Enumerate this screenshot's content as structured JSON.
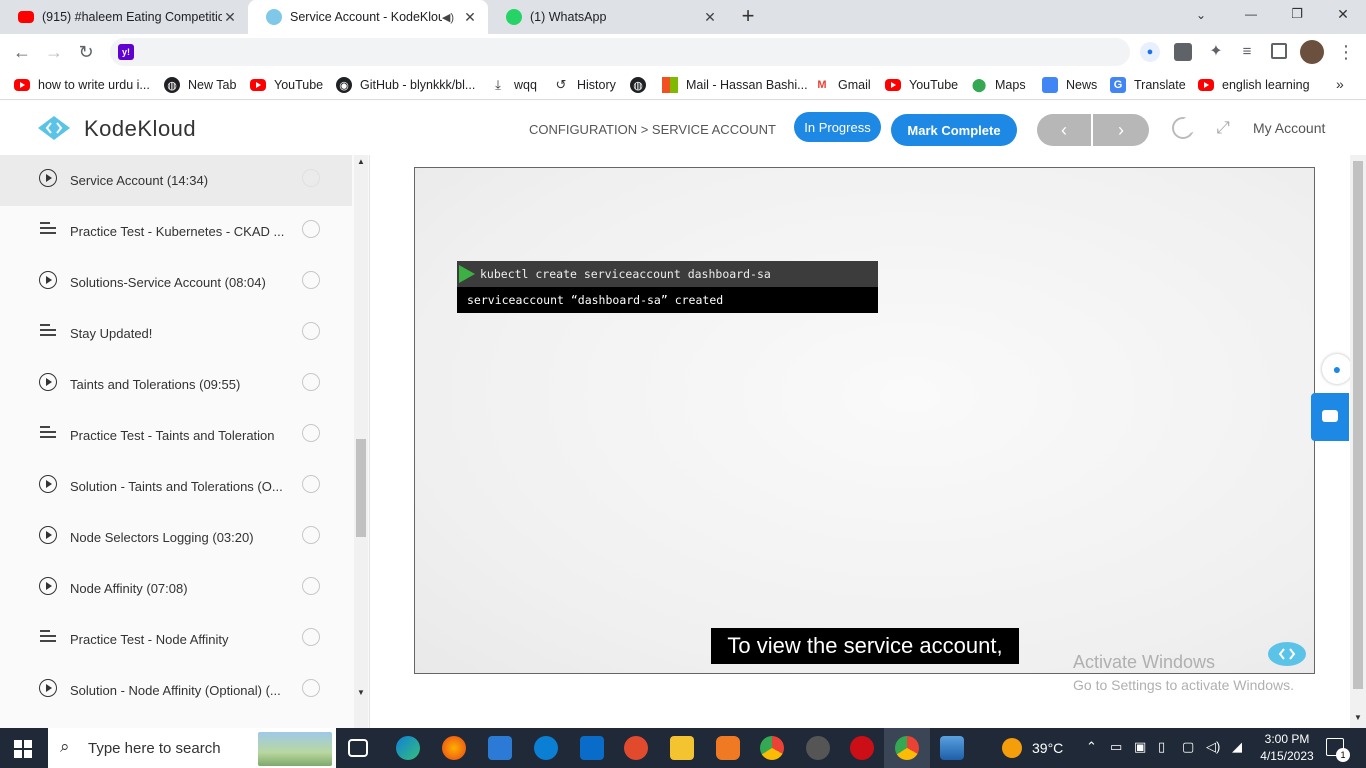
{
  "browser": {
    "tabs": [
      {
        "title": "(915) #haleem Eating Competitio",
        "active": false
      },
      {
        "title": "Service Account - KodeKloud",
        "active": true
      },
      {
        "title": "(1) WhatsApp",
        "active": false
      }
    ],
    "new_tab": "+",
    "window_controls": {
      "minimize": "—",
      "restore": "❐",
      "close": "✕"
    },
    "nav": {
      "back": "←",
      "forward": "→",
      "reload": "↻"
    },
    "address": ""
  },
  "bookmarks": [
    {
      "label": "how to write urdu i...",
      "icon": "youtube-icon"
    },
    {
      "label": "New Tab",
      "icon": "globe-icon"
    },
    {
      "label": "YouTube",
      "icon": "youtube-icon"
    },
    {
      "label": "GitHub - blynkkk/bl...",
      "icon": "github-icon"
    },
    {
      "label": "wqq",
      "icon": "download-icon"
    },
    {
      "label": "History",
      "icon": "history-icon"
    },
    {
      "label": "",
      "icon": "globe-icon"
    },
    {
      "label": "Mail - Hassan Bashi...",
      "icon": "microsoft-icon"
    },
    {
      "label": "Gmail",
      "icon": "gmail-icon"
    },
    {
      "label": "YouTube",
      "icon": "youtube-icon"
    },
    {
      "label": "Maps",
      "icon": "maps-icon"
    },
    {
      "label": "News",
      "icon": "news-icon"
    },
    {
      "label": "Translate",
      "icon": "translate-icon"
    },
    {
      "label": "english learning",
      "icon": "youtube-icon"
    }
  ],
  "app": {
    "brand": "KodeKloud",
    "breadcrumb": "CONFIGURATION > SERVICE ACCOUNT",
    "status_button": "In Progress",
    "complete_button": "Mark Complete",
    "prev": "‹",
    "next": "›",
    "account": "My Account",
    "colors": {
      "accent": "#1e88e5",
      "nav_grey": "#b7b7b7"
    }
  },
  "lessons": [
    {
      "type": "video",
      "title": "Service Account (14:34)",
      "current": true
    },
    {
      "type": "doc",
      "title": "Practice Test - Kubernetes - CKAD ...",
      "current": false
    },
    {
      "type": "video",
      "title": "Solutions-Service Account (08:04)",
      "current": false
    },
    {
      "type": "doc",
      "title": "Stay Updated!",
      "current": false
    },
    {
      "type": "video",
      "title": "Taints and Tolerations (09:55)",
      "current": false
    },
    {
      "type": "doc",
      "title": "Practice Test - Taints and Toleration",
      "current": false
    },
    {
      "type": "video",
      "title": "Solution - Taints and Tolerations (O...",
      "current": false
    },
    {
      "type": "video",
      "title": "Node Selectors Logging (03:20)",
      "current": false
    },
    {
      "type": "video",
      "title": "Node Affinity (07:08)",
      "current": false
    },
    {
      "type": "doc",
      "title": "Practice Test - Node Affinity",
      "current": false
    },
    {
      "type": "video",
      "title": "Solution - Node Affinity (Optional) (...",
      "current": false
    }
  ],
  "video": {
    "terminal_command": "kubectl create serviceaccount dashboard-sa",
    "terminal_output": "serviceaccount “dashboard-sa” created",
    "caption": "To view the service account,"
  },
  "watermark": {
    "title": "Activate Windows",
    "subtitle": "Go to Settings to activate Windows."
  },
  "taskbar": {
    "search_placeholder": "Type here to search",
    "weather": "39°C",
    "time": "3:00 PM",
    "date": "4/15/2023",
    "notifications": "1"
  }
}
